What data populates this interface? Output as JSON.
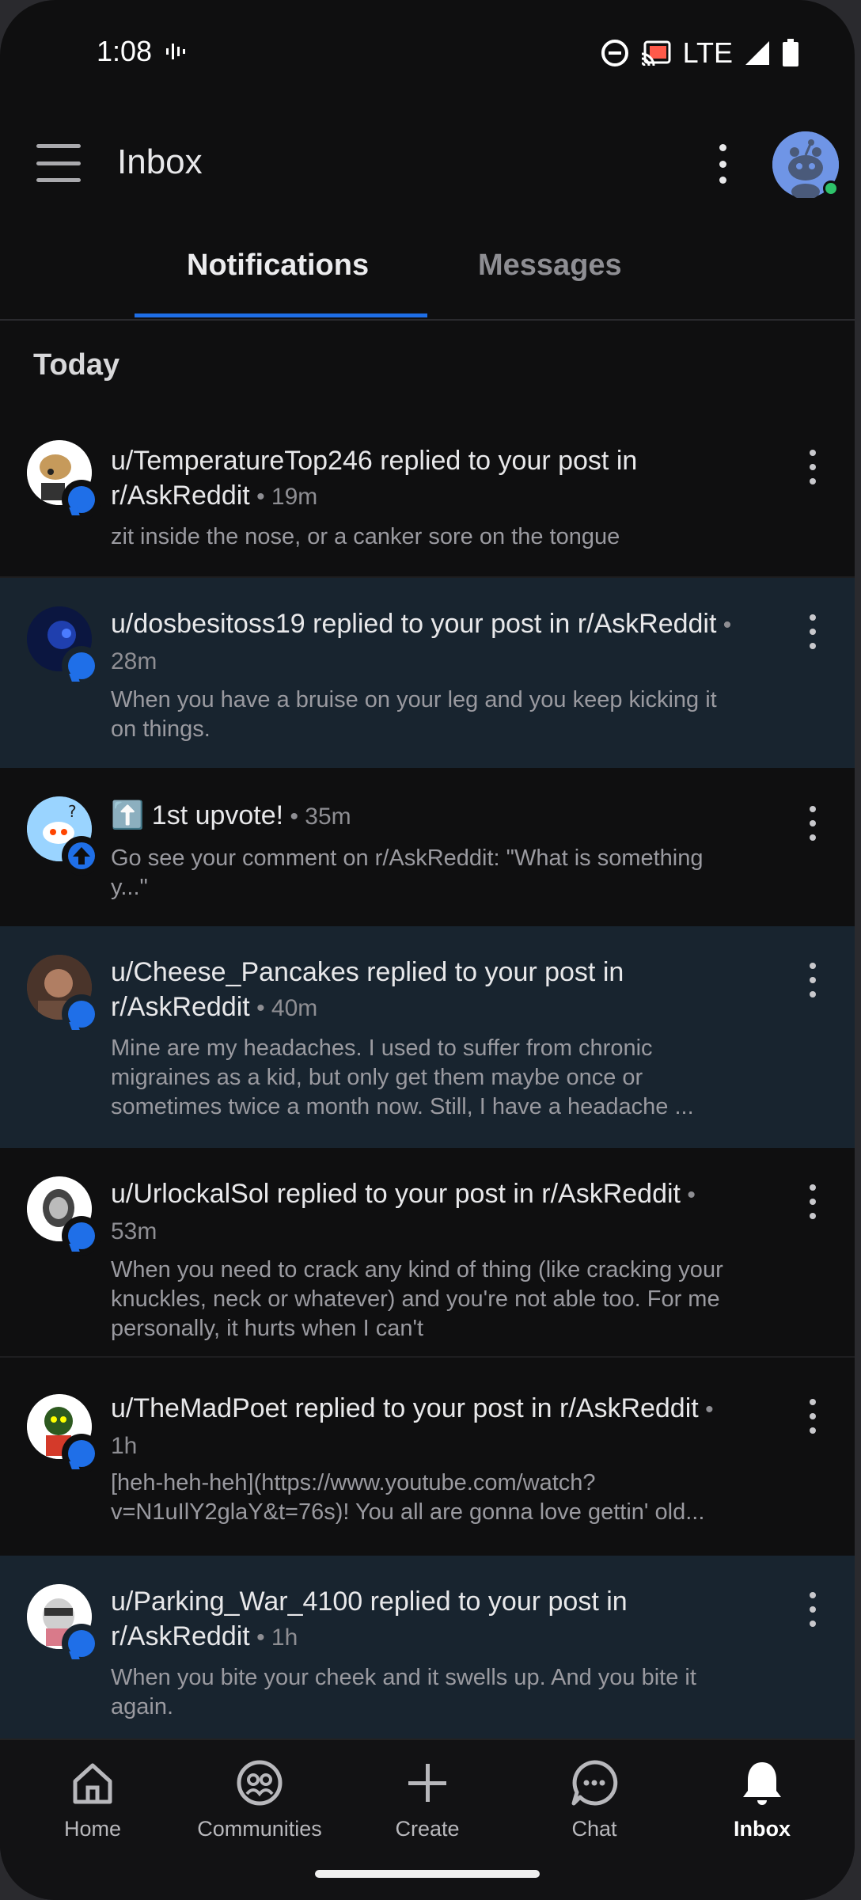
{
  "status_bar": {
    "time": "1:08",
    "network": "LTE",
    "icons": [
      "voice-icon",
      "dnd-icon",
      "cast-icon",
      "signal-icon",
      "battery-icon"
    ]
  },
  "header": {
    "title": "Inbox",
    "icons": [
      "hamburger-menu-icon",
      "overflow-menu-icon",
      "user-avatar"
    ]
  },
  "tabs": [
    {
      "label": "Notifications",
      "active": true
    },
    {
      "label": "Messages",
      "active": false
    }
  ],
  "section": {
    "label": "Today"
  },
  "notifications": [
    {
      "title": "u/TemperatureTop246 replied to your post in r/AskReddit",
      "meta": " • 19m",
      "body": "zit inside the nose, or a canker sore on the tongue",
      "unread": false,
      "badge": "reply-icon"
    },
    {
      "title": "u/dosbesitoss19 replied to your post in r/AskReddit",
      "meta": " • 28m",
      "body": "When you have a bruise on your leg and you keep kicking it on things.",
      "unread": true,
      "badge": "reply-icon"
    },
    {
      "title": "⬆️ 1st upvote!",
      "meta": " • 35m",
      "body": "Go see your comment on r/AskReddit: \"What is something y...\"",
      "unread": false,
      "badge": "upvote-icon"
    },
    {
      "title": "u/Cheese_Pancakes replied to your post in r/AskReddit",
      "meta": " • 40m",
      "body": "Mine are my headaches.  I used to suffer from chronic migraines as a kid, but only get them maybe once or sometimes twice a month now.  Still, I have a headache ...",
      "unread": true,
      "badge": "reply-icon"
    },
    {
      "title": "u/UrlockalSol replied to your post in r/AskReddit",
      "meta": " • 53m",
      "body": "When you need to crack any kind of thing (like cracking your knuckles, neck or whatever) and you're not able too. For me personally, it hurts when I can't",
      "unread": false,
      "badge": "reply-icon"
    },
    {
      "title": "u/TheMadPoet replied to your post in r/AskReddit",
      "meta": " • 1h",
      "body": "[heh-heh-heh](https://www.youtube.com/watch?v=N1uIlY2glaY&t=76s)! You all are gonna love gettin' old...",
      "unread": false,
      "badge": "reply-icon"
    },
    {
      "title": "u/Parking_War_4100 replied to your post in r/AskReddit",
      "meta": " • 1h",
      "body": "When you bite your cheek and it swells up. And you bite it again.",
      "unread": true,
      "badge": "reply-icon"
    }
  ],
  "bottom_nav": [
    {
      "label": "Home",
      "icon": "home-icon",
      "active": false
    },
    {
      "label": "Communities",
      "icon": "communities-icon",
      "active": false
    },
    {
      "label": "Create",
      "icon": "plus-icon",
      "active": false
    },
    {
      "label": "Chat",
      "icon": "chat-icon",
      "active": false
    },
    {
      "label": "Inbox",
      "icon": "bell-icon",
      "active": true
    }
  ],
  "colors": {
    "background": "#0f0f10",
    "unread_background": "#18242f",
    "accent": "#1e6ee6",
    "online": "#2ec26a"
  }
}
